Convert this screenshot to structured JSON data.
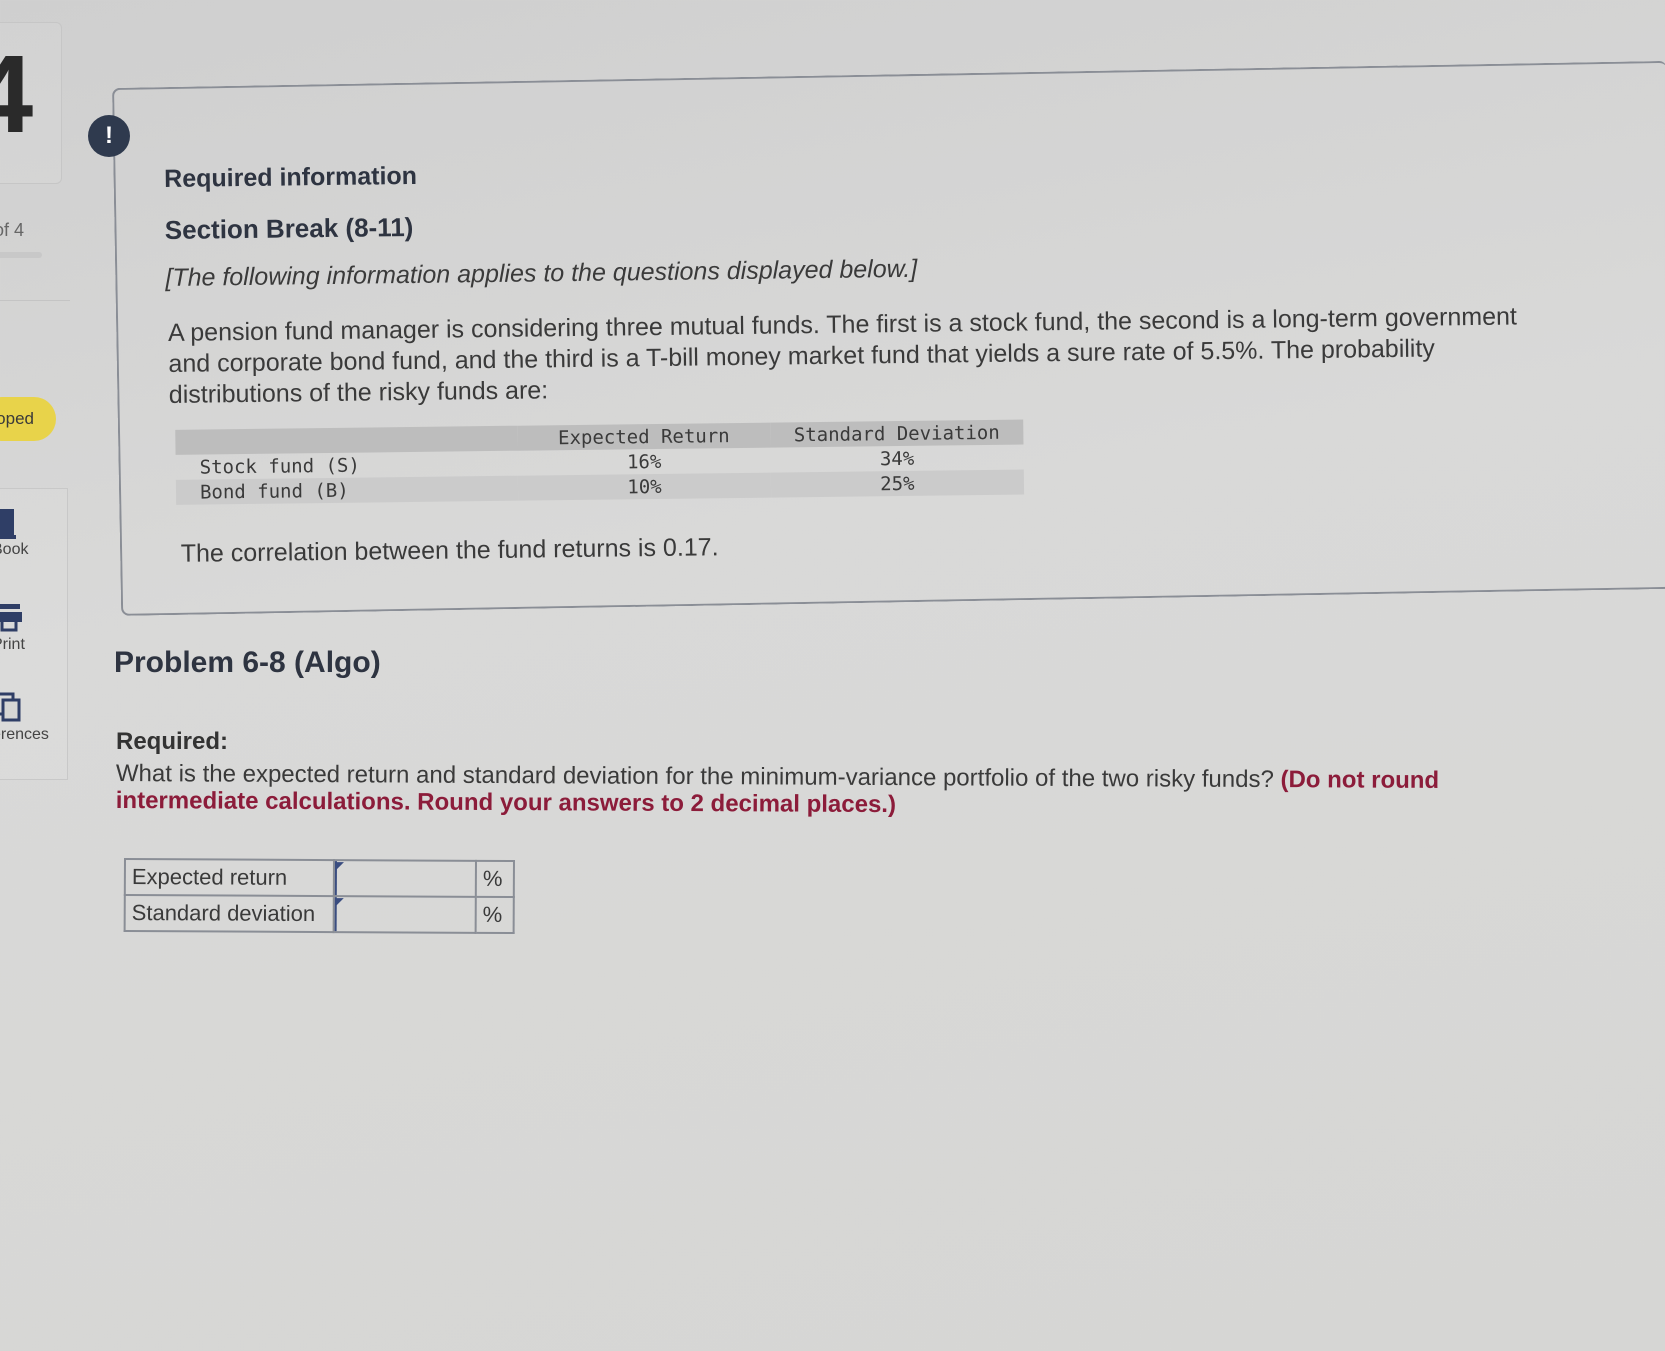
{
  "sidebar": {
    "page_indicator": "of 4",
    "status_pill": "oped",
    "tools": [
      {
        "label": "Book",
        "icon": "book-icon"
      },
      {
        "label": "Print",
        "icon": "print-icon"
      },
      {
        "label": "erences",
        "icon": "references-icon"
      }
    ]
  },
  "info": {
    "badge": "!",
    "title": "Required information",
    "section": "Section Break (8-11)",
    "applies": "[The following information applies to the questions displayed below.]",
    "paragraph_lines": [
      "A pension fund manager is considering three mutual funds. The first is a stock fund, the second is a long-term government",
      "and corporate bond fund, and the third is a T-bill money market fund that yields a sure rate of 5.5%. The probability",
      "distributions of the risky funds are:"
    ],
    "table": {
      "headers": [
        "",
        "Expected Return",
        "Standard Deviation"
      ],
      "rows": [
        [
          "Stock fund (S)",
          "16%",
          "34%"
        ],
        [
          "Bond fund (B)",
          "10%",
          "25%"
        ]
      ]
    },
    "correlation": "The correlation between the fund returns is 0.17."
  },
  "problem": {
    "title": "Problem 6-8 (Algo)",
    "required_label": "Required:",
    "question": "What is the expected return and standard deviation for the minimum-variance portfolio of the two risky funds?",
    "instruction": "(Do not round intermediate calculations. Round your answers to 2 decimal places.)",
    "answers": [
      {
        "label": "Expected return",
        "value": "",
        "unit": "%"
      },
      {
        "label": "Standard deviation",
        "value": "",
        "unit": "%"
      }
    ]
  },
  "colors": {
    "badge": "#2f3a4e",
    "instruction": "#8c1c3a",
    "pill": "#e8d34a"
  }
}
